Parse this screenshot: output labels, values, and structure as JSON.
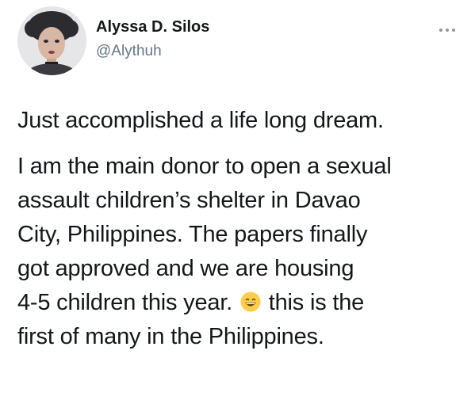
{
  "tweet": {
    "author": {
      "display_name": "Alyssa D. Silos",
      "handle": "@Alythuh",
      "avatar_icon": "profile-photo"
    },
    "more_icon": "more-dots-icon",
    "text_first_paragraph": "Just accomplished a life long dream.",
    "text_lines": [
      "I am the main donor to open a sexual",
      "assault children’s shelter in Davao",
      "City, Philippines. The papers finally",
      "got approved and we are housing",
      "4-5 children this year.",
      "this is the",
      "first of many in the Philippines."
    ],
    "emoji": "grinning-face-with-smiling-eyes"
  },
  "colors": {
    "text": "#14171a",
    "secondary": "#657786",
    "dots": "#8899a6",
    "emoji_yellow": "#ffcc4d"
  }
}
